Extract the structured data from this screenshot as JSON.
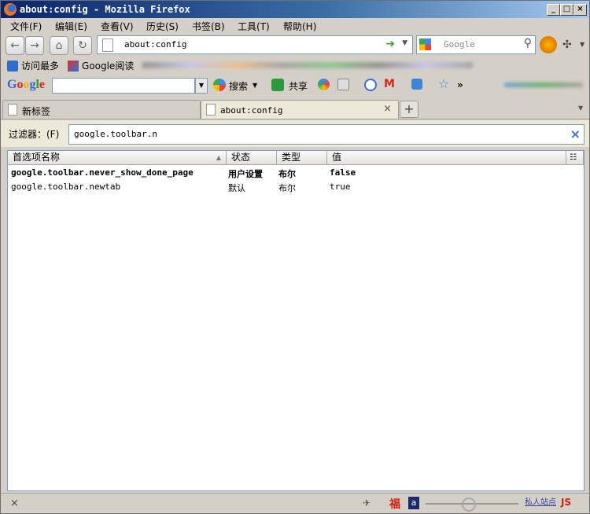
{
  "window": {
    "title": "about:config - Mozilla Firefox"
  },
  "menu": [
    "文件(F)",
    "编辑(E)",
    "查看(V)",
    "历史(S)",
    "书签(B)",
    "工具(T)",
    "帮助(H)"
  ],
  "nav": {
    "url": "about:config",
    "search_placeholder": "Google"
  },
  "bookmarks": [
    {
      "label": "访问最多"
    },
    {
      "label": "Google阅读"
    }
  ],
  "google_toolbar": {
    "logo": "Google",
    "search_label": "搜索",
    "share_label": "共享",
    "more": "»"
  },
  "tabs": [
    {
      "label": "新标签",
      "active": false
    },
    {
      "label": "about:config",
      "active": true
    }
  ],
  "filter": {
    "label": "过滤器：(F)",
    "value": "google.toolbar.n"
  },
  "table": {
    "columns": [
      "首选项名称",
      "状态",
      "类型",
      "值"
    ],
    "rows": [
      {
        "name": "google.toolbar.never_show_done_page",
        "status": "用户设置",
        "type": "布尔",
        "value": "false",
        "modified": true
      },
      {
        "name": "google.toolbar.newtab",
        "status": "默认",
        "type": "布尔",
        "value": "true",
        "modified": false
      }
    ]
  },
  "status": {
    "close": "×",
    "addon_label": "私人站点"
  },
  "colors": {
    "titlebar_start": "#0a246a",
    "titlebar_end": "#a6caf0",
    "accent": "#3a6ed8"
  }
}
